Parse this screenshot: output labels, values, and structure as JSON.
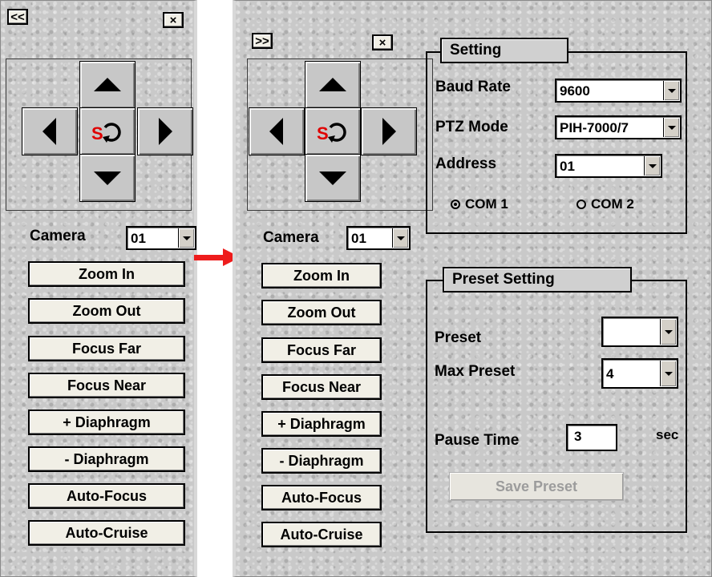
{
  "left_panel": {
    "expand_label": "<<",
    "close_label": "×",
    "camera_label": "Camera",
    "camera_value": "01",
    "commands": [
      "Zoom In",
      "Zoom Out",
      "Focus Far",
      "Focus Near",
      "+ Diaphragm",
      "- Diaphragm",
      "Auto-Focus",
      "Auto-Cruise"
    ]
  },
  "right_panel": {
    "collapse_label": ">>",
    "close_label": "×",
    "camera_label": "Camera",
    "camera_value": "01",
    "commands": [
      "Zoom In",
      "Zoom Out",
      "Focus Far",
      "Focus Near",
      "+ Diaphragm",
      "- Diaphragm",
      "Auto-Focus",
      "Auto-Cruise"
    ],
    "setting": {
      "title": "Setting",
      "baud_rate_label": "Baud Rate",
      "baud_rate_value": "9600",
      "ptz_mode_label": "PTZ Mode",
      "ptz_mode_value": "PIH-7000/7",
      "address_label": "Address",
      "address_value": "01",
      "com1_label": "COM 1",
      "com2_label": "COM 2",
      "selected_com": "COM 1"
    },
    "preset": {
      "title": "Preset Setting",
      "preset_label": "Preset",
      "preset_value": "",
      "max_preset_label": "Max Preset",
      "max_preset_value": "4",
      "pause_time_label": "Pause Time",
      "pause_time_value": "3",
      "pause_unit": "sec",
      "save_label": "Save Preset",
      "save_enabled": false
    }
  },
  "ptz_center_letter": "S",
  "colors": {
    "panel_bg": "#c9c9c9",
    "button_face": "#f1efe6",
    "transition_arrow": "#ee1c1c",
    "center_letter": "#e00000"
  },
  "icons": {
    "pan_up": "triangle-up-icon",
    "pan_down": "triangle-down-icon",
    "pan_left": "triangle-left-icon",
    "pan_right": "triangle-right-icon",
    "center": "s-rotate-icon",
    "transition": "red-arrow-right-icon"
  }
}
